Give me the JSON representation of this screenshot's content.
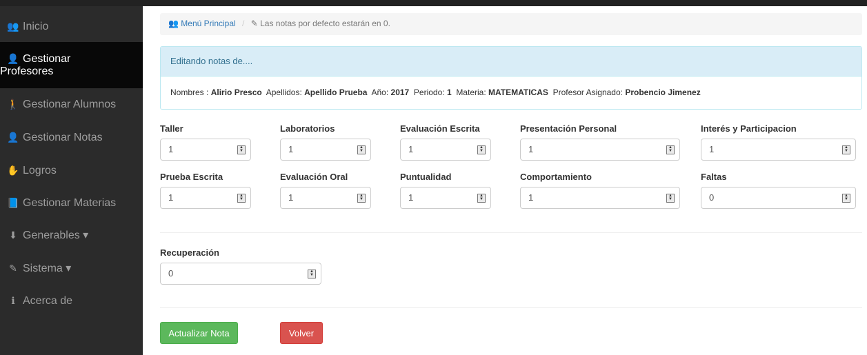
{
  "sidebar": {
    "items": [
      {
        "icon": "users-icon",
        "glyph": "👥",
        "label": "Inicio"
      },
      {
        "icon": "male-icon",
        "glyph": "👤",
        "label_line1": "Gestionar",
        "label_line2": "Profesores",
        "active": true
      },
      {
        "icon": "child-icon",
        "glyph": "🚶",
        "label": "Gestionar Alumnos"
      },
      {
        "icon": "male-icon",
        "glyph": "👤",
        "label": "Gestionar Notas"
      },
      {
        "icon": "sign-language-icon",
        "glyph": "✋",
        "label": "Logros"
      },
      {
        "icon": "book-icon",
        "glyph": "📘",
        "label": "Gestionar Materias"
      },
      {
        "icon": "download-icon",
        "glyph": "⬇",
        "label": "Generables ▾"
      },
      {
        "icon": "edit-icon",
        "glyph": "✎",
        "label": "Sistema ▾"
      },
      {
        "icon": "info-circle-icon",
        "glyph": "ℹ",
        "label": "Acerca de"
      }
    ]
  },
  "breadcrumb": {
    "home_label": "Menú Principal",
    "note": "Las notas por defecto estarán en 0."
  },
  "panel": {
    "heading": "Editando notas de....",
    "nombres_label": "Nombres :",
    "nombres_value": "Alirio Presco",
    "apellidos_label": "Apellidos:",
    "apellidos_value": "Apellido Prueba",
    "anio_label": "Año:",
    "anio_value": "2017",
    "periodo_label": "Periodo:",
    "periodo_value": "1",
    "materia_label": "Materia:",
    "materia_value": "MATEMATICAS",
    "profesor_label": "Profesor Asignado:",
    "profesor_value": "Probencio  Jimenez"
  },
  "fields": [
    {
      "label": "Taller",
      "value": "1"
    },
    {
      "label": "Laboratorios",
      "value": "1"
    },
    {
      "label": "Evaluación Escrita",
      "value": "1"
    },
    {
      "label": "Presentación Personal",
      "value": "1"
    },
    {
      "label": "Interés y Participacion",
      "value": "1"
    },
    {
      "label": "Prueba Escrita",
      "value": "1"
    },
    {
      "label": "Evaluación Oral",
      "value": "1"
    },
    {
      "label": "Puntualidad",
      "value": "1"
    },
    {
      "label": "Comportamiento",
      "value": "1"
    },
    {
      "label": "Faltas",
      "value": "0"
    }
  ],
  "recuperacion": {
    "label": "Recuperación",
    "value": "0"
  },
  "buttons": {
    "update_label": "Actualizar Nota",
    "back_label": "Volver"
  },
  "colors": {
    "sidebar_bg": "#2b2b2b",
    "active_bg": "#080808",
    "success": "#5cb85c",
    "danger": "#d9534f",
    "info_bg": "#d9edf7"
  }
}
